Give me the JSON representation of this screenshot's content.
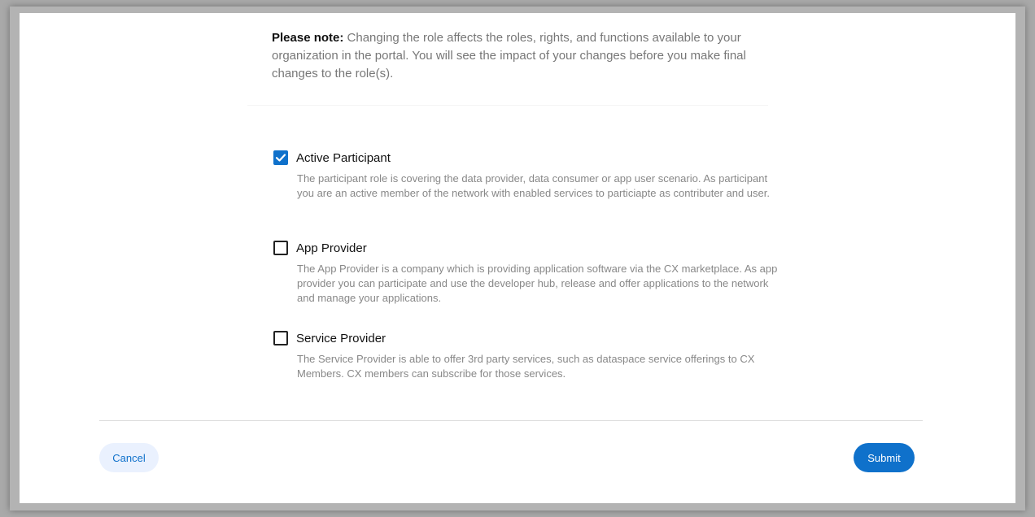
{
  "note": {
    "label": "Please note:",
    "text": " Changing the role affects the roles, rights, and functions available to your organization in the portal. You will see the impact of your changes before you make final changes to the role(s)."
  },
  "roles": [
    {
      "label": "Active Participant",
      "checked": true,
      "description": "The participant role is covering the data provider, data consumer or app user scenario. As participant you are an active member of the network with enabled services to particiapte as contributer and user."
    },
    {
      "label": "App Provider",
      "checked": false,
      "description": "The App Provider is a company which is providing application software via the CX marketplace. As app provider you can participate and use the developer hub, release and offer applications to the network and manage your applications."
    },
    {
      "label": "Service Provider",
      "checked": false,
      "description": "The Service Provider is able to offer 3rd party services, such as dataspace service offerings to CX Members. CX members can subscribe for those services."
    }
  ],
  "footer": {
    "cancel_label": "Cancel",
    "submit_label": "Submit"
  },
  "colors": {
    "primary": "#0f71cb",
    "cancel_bg": "#eaf1fe"
  }
}
